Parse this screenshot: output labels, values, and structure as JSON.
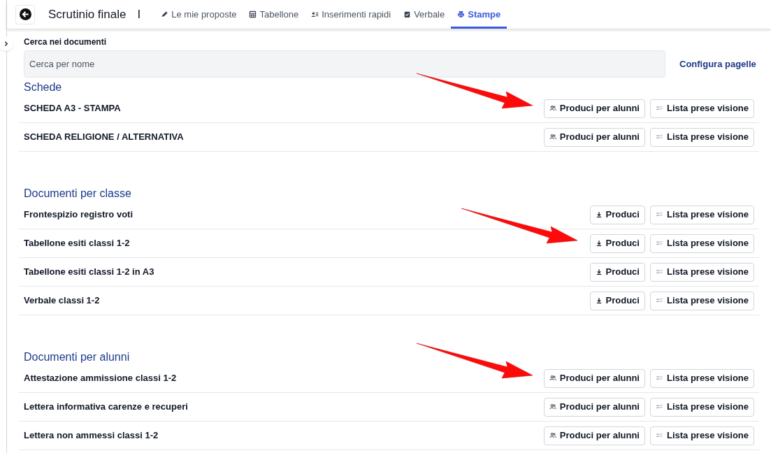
{
  "header": {
    "title": "Scrutinio finale",
    "title_suffix": "I"
  },
  "tabs": [
    {
      "label": "Le mie proposte",
      "selected": false
    },
    {
      "label": "Tabellone",
      "selected": false
    },
    {
      "label": "Inserimenti rapidi",
      "selected": false
    },
    {
      "label": "Verbale",
      "selected": false
    },
    {
      "label": "Stampe",
      "selected": true
    }
  ],
  "search": {
    "label": "Cerca nei documenti",
    "placeholder": "Cerca per nome"
  },
  "configure_link": "Configura pagelle",
  "sections": [
    {
      "title": "Schede",
      "rows": [
        {
          "name": "SCHEDA A3 - STAMPA",
          "produce": {
            "kind": "students",
            "label": "Produci per alunni"
          },
          "list": "Lista prese visione",
          "arrow": true
        },
        {
          "name": "SCHEDA RELIGIONE / ALTERNATIVA",
          "produce": {
            "kind": "students",
            "label": "Produci per alunni"
          },
          "list": "Lista prese visione",
          "arrow": false
        }
      ]
    },
    {
      "title": "Documenti per classe",
      "rows": [
        {
          "name": "Frontespizio registro voti",
          "produce": {
            "kind": "download",
            "label": "Produci"
          },
          "list": "Lista prese visione",
          "arrow": false
        },
        {
          "name": "Tabellone esiti classi 1-2",
          "produce": {
            "kind": "download",
            "label": "Produci"
          },
          "list": "Lista prese visione",
          "arrow": true
        },
        {
          "name": "Tabellone esiti classi 1-2 in A3",
          "produce": {
            "kind": "download",
            "label": "Produci"
          },
          "list": "Lista prese visione",
          "arrow": false
        },
        {
          "name": "Verbale classi 1-2",
          "produce": {
            "kind": "download",
            "label": "Produci"
          },
          "list": "Lista prese visione",
          "arrow": false
        }
      ]
    },
    {
      "title": "Documenti per alunni",
      "rows": [
        {
          "name": "Attestazione ammissione classi 1-2",
          "produce": {
            "kind": "students",
            "label": "Produci per alunni"
          },
          "list": "Lista prese visione",
          "arrow": true
        },
        {
          "name": "Lettera informativa carenze e recuperi",
          "produce": {
            "kind": "students",
            "label": "Produci per alunni"
          },
          "list": "Lista prese visione",
          "arrow": false
        },
        {
          "name": "Lettera non ammessi classi 1-2",
          "produce": {
            "kind": "students",
            "label": "Produci per alunni"
          },
          "list": "Lista prese visione",
          "arrow": false
        }
      ]
    }
  ]
}
